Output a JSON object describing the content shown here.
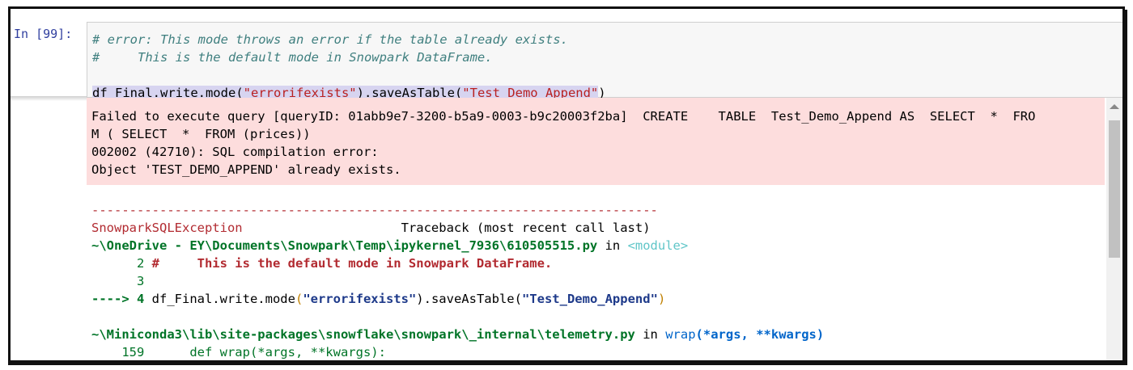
{
  "cell": {
    "prompt": "In [99]:",
    "input_lines": [
      "# error: This mode throws an error if the table already exists.",
      "#     This is the default mode in Snowpark DataFrame."
    ],
    "code": {
      "part1": "df_Final.write.mode",
      "paren_open": "(",
      "arg1": "\"errorifexists\"",
      "mid": ").saveAsTable(",
      "arg2": "\"Test_Demo_Append\"",
      "paren_close": ")"
    }
  },
  "error_box": {
    "lines": [
      "Failed to execute query [queryID: 01abb9e7-3200-b5a9-0003-b9c20003f2ba]  CREATE    TABLE  Test_Demo_Append AS  SELECT  *  FRO",
      "M ( SELECT  *  FROM (prices))",
      "002002 (42710): SQL compilation error:",
      "Object 'TEST_DEMO_APPEND' already exists."
    ]
  },
  "traceback": {
    "dashes": "---------------------------------------------------------------------------",
    "exception": "SnowparkSQLException",
    "traceback_label": "                     Traceback (most recent call last)",
    "file1": "~\\OneDrive - EY\\Documents\\Snowpark\\Temp\\ipykernel_7936\\610505515.py",
    "in_word": " in ",
    "module": "<module>",
    "line2_num": "      2 ",
    "line2_code": "#     This is the default mode in Snowpark DataFrame.",
    "line3_num": "      3",
    "arrow": "----> 4 ",
    "line4_a": "df_Final.write.mode",
    "line4_b": "(",
    "line4_c": "\"errorifexists\"",
    "line4_d": ").saveAsTable(",
    "line4_e": "\"Test_Demo_Append\"",
    "line4_f": ")",
    "file2": "~\\Miniconda3\\lib\\site-packages\\snowflake\\snowpark\\_internal\\telemetry.py",
    "func2": "wrap",
    "func2_args": "(*args, **kwargs)",
    "line159": "    159      def wrap(*args, **kwargs):"
  }
}
